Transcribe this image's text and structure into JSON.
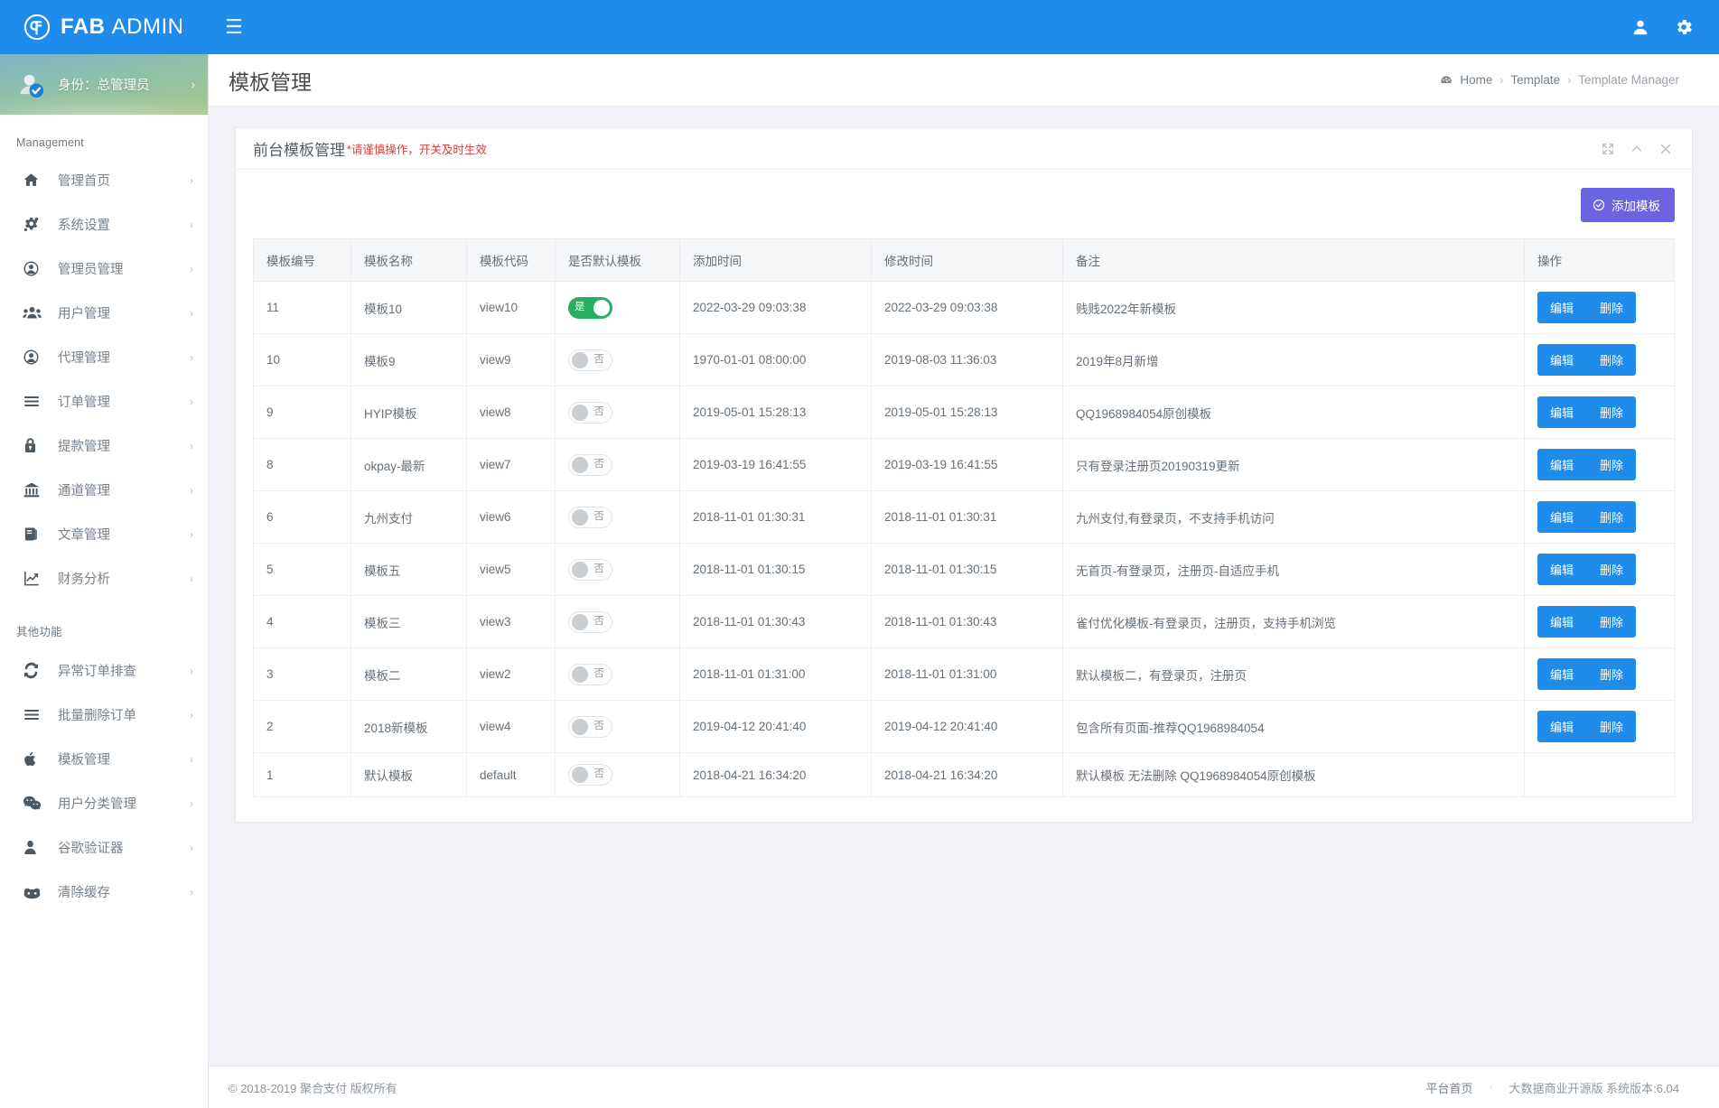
{
  "navbar": {
    "brand_bold": "FAB",
    "brand_light": "ADMIN",
    "logo_icon": "leaf-logo-icon",
    "toggle_icon": "hamburger-icon",
    "user_icon": "user-icon",
    "settings_icon": "gear-icon",
    "accent_color": "#1f8ceb"
  },
  "sidebar": {
    "profile": {
      "label": "身份：总管理员",
      "avatar_icon": "avatar-verified-icon",
      "arrow": "›"
    },
    "group1_heading": "Management",
    "group2_heading": "其他功能",
    "arrow": "›",
    "group1_items": [
      {
        "label": "管理首页",
        "icon": "home-icon"
      },
      {
        "label": "系统设置",
        "icon": "gears-icon"
      },
      {
        "label": "管理员管理",
        "icon": "user-circle-icon"
      },
      {
        "label": "用户管理",
        "icon": "users-icon"
      },
      {
        "label": "代理管理",
        "icon": "user-circle-icon"
      },
      {
        "label": "订单管理",
        "icon": "list-icon"
      },
      {
        "label": "提款管理",
        "icon": "lock-icon"
      },
      {
        "label": "通道管理",
        "icon": "bank-icon"
      },
      {
        "label": "文章管理",
        "icon": "book-icon"
      },
      {
        "label": "财务分析",
        "icon": "chart-line-icon"
      }
    ],
    "group2_items": [
      {
        "label": "异常订单排查",
        "icon": "refresh-icon"
      },
      {
        "label": "批量删除订单",
        "icon": "list-icon"
      },
      {
        "label": "模板管理",
        "icon": "apple-icon"
      },
      {
        "label": "用户分类管理",
        "icon": "wechat-icon"
      },
      {
        "label": "谷歌验证器",
        "icon": "user-solid-icon"
      },
      {
        "label": "清除缓存",
        "icon": "cloud-icon"
      }
    ]
  },
  "page": {
    "title": "模板管理",
    "breadcrumb": {
      "home_icon": "dashboard-icon",
      "home": "Home",
      "sep": "›",
      "level2": "Template",
      "current": "Template Manager"
    }
  },
  "panel": {
    "title": "前台模板管理",
    "subtitle": "*请谨慎操作，开关及时生效",
    "tools": {
      "expand_icon": "expand-icon",
      "collapse_icon": "chevron-up-icon",
      "close_icon": "close-icon"
    },
    "add_button": {
      "label": "添加模板",
      "icon": "check-circle-icon",
      "color": "#6c63e0"
    }
  },
  "table": {
    "columns": [
      "模板编号",
      "模板名称",
      "模板代码",
      "是否默认模板",
      "添加时间",
      "修改时间",
      "备注",
      "操作"
    ],
    "switch_on_label": "是",
    "switch_off_label": "否",
    "actions": {
      "edit": "编辑",
      "delete": "删除"
    },
    "rows": [
      {
        "id": "11",
        "name": "模板10",
        "code": "view10",
        "is_default": true,
        "added": "2022-03-29 09:03:38",
        "modified": "2022-03-29 09:03:38",
        "remark": "贱贱2022年新模板",
        "has_actions": true
      },
      {
        "id": "10",
        "name": "模板9",
        "code": "view9",
        "is_default": false,
        "added": "1970-01-01 08:00:00",
        "modified": "2019-08-03 11:36:03",
        "remark": "2019年8月新增",
        "has_actions": true
      },
      {
        "id": "9",
        "name": "HYIP模板",
        "code": "view8",
        "is_default": false,
        "added": "2019-05-01 15:28:13",
        "modified": "2019-05-01 15:28:13",
        "remark": "QQ1968984054原创模板",
        "has_actions": true
      },
      {
        "id": "8",
        "name": "okpay-最新",
        "code": "view7",
        "is_default": false,
        "added": "2019-03-19 16:41:55",
        "modified": "2019-03-19 16:41:55",
        "remark": "只有登录注册页20190319更新",
        "has_actions": true
      },
      {
        "id": "6",
        "name": "九州支付",
        "code": "view6",
        "is_default": false,
        "added": "2018-11-01 01:30:31",
        "modified": "2018-11-01 01:30:31",
        "remark": "九州支付,有登录页，不支持手机访问",
        "has_actions": true
      },
      {
        "id": "5",
        "name": "模板五",
        "code": "view5",
        "is_default": false,
        "added": "2018-11-01 01:30:15",
        "modified": "2018-11-01 01:30:15",
        "remark": "无首页-有登录页，注册页-自适应手机",
        "has_actions": true
      },
      {
        "id": "4",
        "name": "模板三",
        "code": "view3",
        "is_default": false,
        "added": "2018-11-01 01:30:43",
        "modified": "2018-11-01 01:30:43",
        "remark": "雀付优化模板-有登录页，注册页，支持手机浏览",
        "has_actions": true
      },
      {
        "id": "3",
        "name": "模板二",
        "code": "view2",
        "is_default": false,
        "added": "2018-11-01 01:31:00",
        "modified": "2018-11-01 01:31:00",
        "remark": "默认模板二，有登录页，注册页",
        "has_actions": true
      },
      {
        "id": "2",
        "name": "2018新模板",
        "code": "view4",
        "is_default": false,
        "added": "2019-04-12 20:41:40",
        "modified": "2019-04-12 20:41:40",
        "remark": "包含所有页面-推荐QQ1968984054",
        "has_actions": true
      },
      {
        "id": "1",
        "name": "默认模板",
        "code": "default",
        "is_default": false,
        "added": "2018-04-21 16:34:20",
        "modified": "2018-04-21 16:34:20",
        "remark": "默认模板 无法删除 QQ1968984054原创模板",
        "has_actions": false
      }
    ]
  },
  "footer": {
    "copyright": "© 2018-2019 聚合支付 版权所有",
    "link": "平台首页",
    "dot": "·",
    "version": "大数据商业开源版 系统版本:6.04"
  }
}
